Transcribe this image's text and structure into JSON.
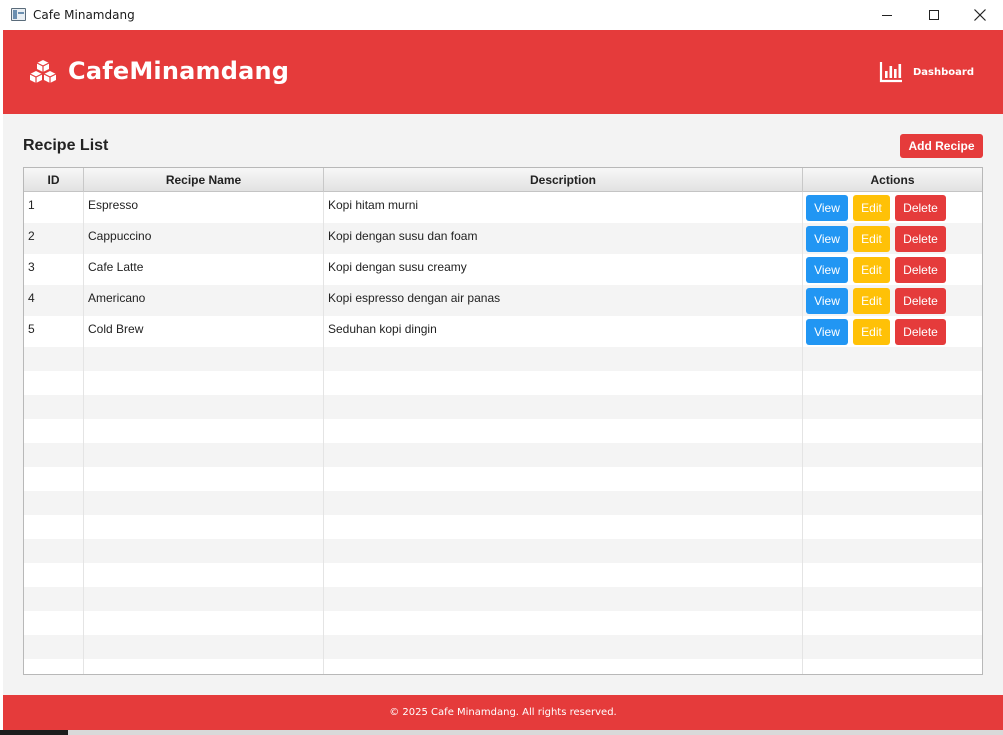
{
  "window": {
    "title": "Cafe Minamdang",
    "icon": "app-window-icon",
    "controls": [
      "minimize-icon",
      "maximize-icon",
      "close-icon"
    ]
  },
  "header": {
    "brand": "CafeMinamdang",
    "brand_icon": "cubes-icon",
    "dashboard_label": "Dashboard",
    "dashboard_icon": "bar-chart-icon",
    "color": "#e53b3b"
  },
  "page": {
    "title": "Recipe List",
    "add_button": "Add Recipe"
  },
  "table": {
    "columns": [
      "ID",
      "Recipe Name",
      "Description",
      "Actions"
    ],
    "rows": [
      {
        "id": "1",
        "name": "Espresso",
        "description": "Kopi hitam murni"
      },
      {
        "id": "2",
        "name": "Cappuccino",
        "description": "Kopi dengan susu dan foam"
      },
      {
        "id": "3",
        "name": "Cafe Latte",
        "description": "Kopi dengan susu creamy"
      },
      {
        "id": "4",
        "name": "Americano",
        "description": "Kopi espresso dengan air panas"
      },
      {
        "id": "5",
        "name": "Cold Brew",
        "description": "Seduhan kopi dingin"
      }
    ],
    "actions": {
      "view": "View",
      "edit": "Edit",
      "delete": "Delete"
    },
    "action_colors": {
      "view": "#2196f3",
      "edit": "#ffc107",
      "delete": "#e53b3b"
    }
  },
  "footer": {
    "text": "© 2025 Cafe Minamdang. All rights reserved."
  }
}
